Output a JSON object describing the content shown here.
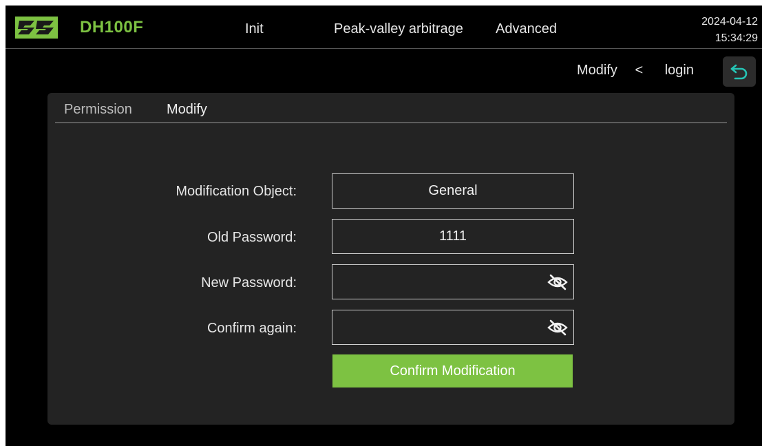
{
  "header": {
    "app_title": "DH100F",
    "nav": {
      "init": "Init",
      "peak_valley": "Peak-valley arbitrage",
      "advanced": "Advanced"
    },
    "date": "2024-04-12",
    "time": "15:34:29"
  },
  "breadcrumb": {
    "current": "Modify",
    "separator": "<",
    "parent": "login"
  },
  "tabs": {
    "permission": "Permission",
    "modify": "Modify"
  },
  "form": {
    "object_label": "Modification Object:",
    "object_value": "General",
    "old_label": "Old Password:",
    "old_value": "1111",
    "new_label": "New Password:",
    "new_value": "",
    "confirm_label": "Confirm again:",
    "confirm_value": ""
  },
  "confirm_button": "Confirm Modification",
  "colors": {
    "accent": "#7dc242",
    "back_icon": "#25c4b5",
    "background": "#000000",
    "panel": "#232323"
  },
  "icons": {
    "logo": "brand-logo",
    "back": "return-arrow-icon",
    "eye": "eye-slash-icon"
  }
}
